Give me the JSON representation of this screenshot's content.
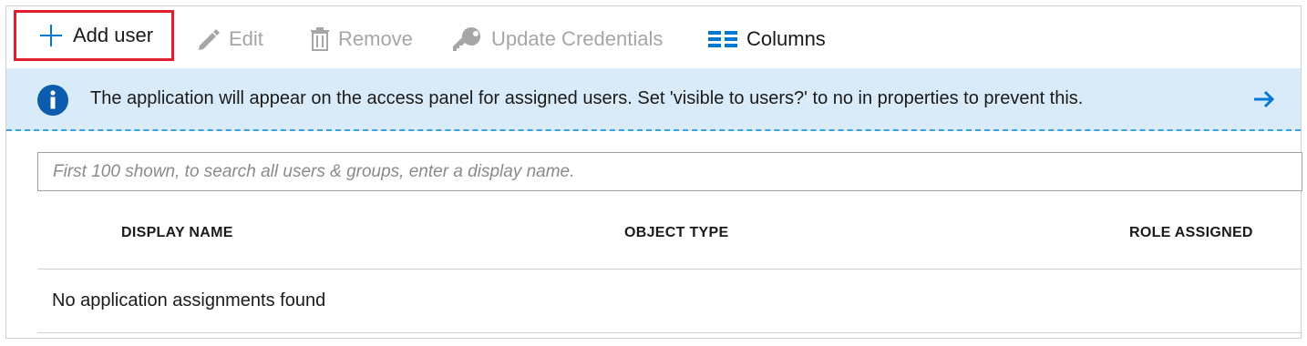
{
  "toolbar": {
    "add_user_label": "Add user",
    "edit_label": "Edit",
    "remove_label": "Remove",
    "update_credentials_label": "Update Credentials",
    "columns_label": "Columns"
  },
  "banner": {
    "message": "The application will appear on the access panel for assigned users. Set 'visible to users?' to no in properties to prevent this.",
    "icon": "info-icon",
    "link_icon": "arrow-right-icon"
  },
  "search": {
    "placeholder": "First 100 shown, to search all users & groups, enter a display name.",
    "value": ""
  },
  "table": {
    "columns": [
      "DISPLAY NAME",
      "OBJECT TYPE",
      "ROLE ASSIGNED"
    ],
    "empty_message": "No application assignments found"
  },
  "colors": {
    "highlight": "#e01e2e",
    "accent": "#0078d4",
    "banner_bg": "#d9ebf8",
    "disabled_text": "#a6a6a6"
  }
}
